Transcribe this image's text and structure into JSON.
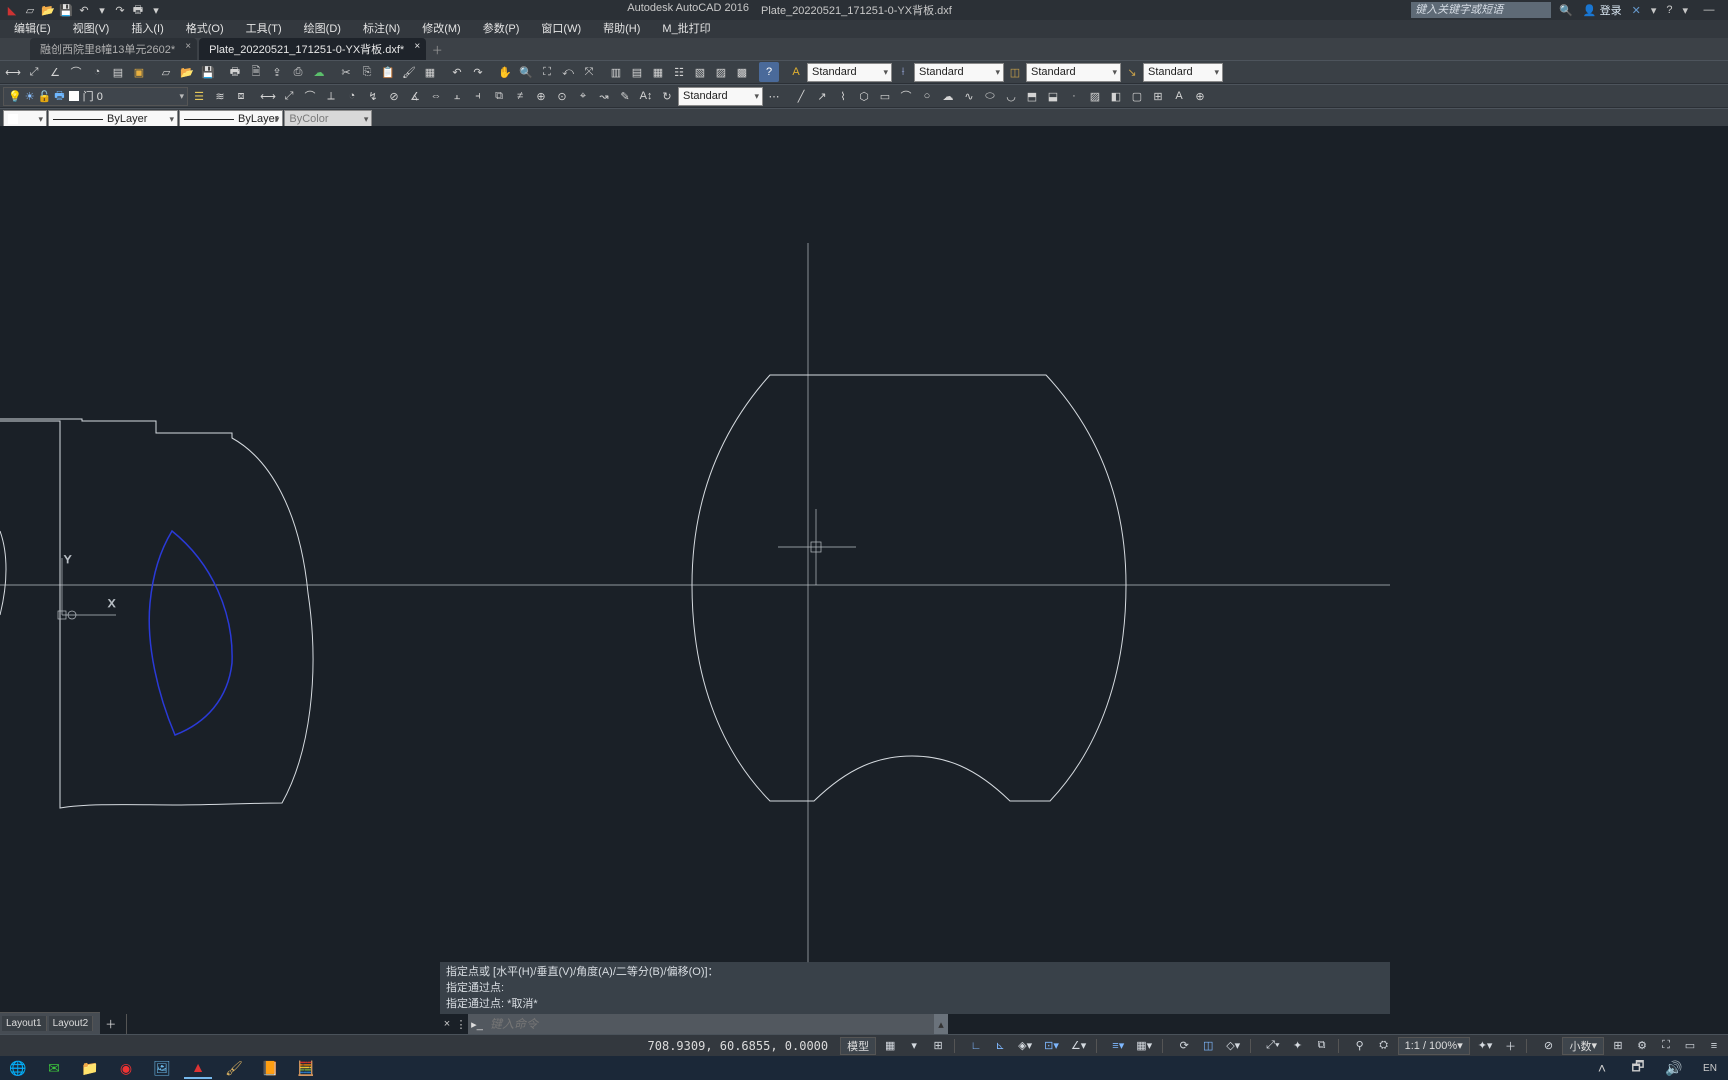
{
  "title": {
    "app": "Autodesk AutoCAD 2016",
    "doc": "Plate_20220521_171251-0-YX背板.dxf"
  },
  "search_placeholder": "键入关键字或短语",
  "login_label": "登录",
  "menus": [
    "编辑(E)",
    "视图(V)",
    "插入(I)",
    "格式(O)",
    "工具(T)",
    "绘图(D)",
    "标注(N)",
    "修改(M)",
    "参数(P)",
    "窗口(W)",
    "帮助(H)",
    "M_批打印"
  ],
  "tabs": [
    {
      "label": "融创西院里8幢13单元2602*",
      "active": false
    },
    {
      "label": "Plate_20220521_171251-0-YX背板.dxf*",
      "active": true
    }
  ],
  "styles": {
    "text": "Standard",
    "dim": "Standard",
    "table": "Standard",
    "mleader": "Standard",
    "annot": "Standard"
  },
  "layer": {
    "current": "门 0",
    "lt": "ByLayer",
    "lw": "ByLayer",
    "color": "ByColor"
  },
  "layout_tabs": [
    "Layout1",
    "Layout2"
  ],
  "cmd_history": [
    "指定点或 [水平(H)/垂直(V)/角度(A)/二等分(B)/偏移(O)]：",
    "指定通过点:",
    "指定通过点: *取消*"
  ],
  "cmd_placeholder": "键入命令",
  "status": {
    "coords": "708.9309, 60.6855, 0.0000",
    "model": "模型",
    "scale": "1:1 / 100%",
    "units": "小数"
  },
  "winbuttons": {
    "min": "—"
  }
}
